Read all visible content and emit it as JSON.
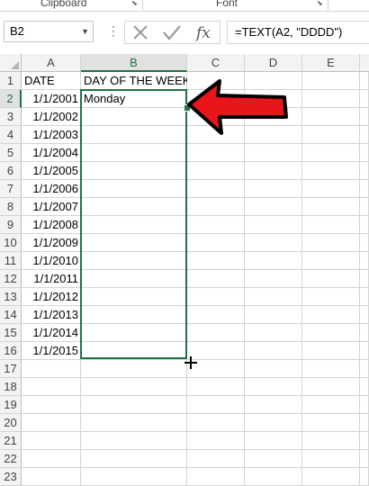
{
  "ribbon": {
    "groups": [
      {
        "label": "Clipboard"
      },
      {
        "label": "Font"
      }
    ]
  },
  "formula_bar": {
    "name_box": "B2",
    "formula": "=TEXT(A2, \"DDDD\")",
    "icons": [
      "cancel-icon",
      "enter-icon",
      "insert-function-icon"
    ]
  },
  "columns": [
    "A",
    "B",
    "C",
    "D",
    "E"
  ],
  "selected_column": "B",
  "selected_row": "2",
  "rows": [
    {
      "num": "1",
      "a": "DATE",
      "b": "DAY OF THE WEEK"
    },
    {
      "num": "2",
      "a": "1/1/2001",
      "b": "Monday"
    },
    {
      "num": "3",
      "a": "1/1/2002",
      "b": ""
    },
    {
      "num": "4",
      "a": "1/1/2003",
      "b": ""
    },
    {
      "num": "5",
      "a": "1/1/2004",
      "b": ""
    },
    {
      "num": "6",
      "a": "1/1/2005",
      "b": ""
    },
    {
      "num": "7",
      "a": "1/1/2006",
      "b": ""
    },
    {
      "num": "8",
      "a": "1/1/2007",
      "b": ""
    },
    {
      "num": "9",
      "a": "1/1/2008",
      "b": ""
    },
    {
      "num": "10",
      "a": "1/1/2009",
      "b": ""
    },
    {
      "num": "11",
      "a": "1/1/2010",
      "b": ""
    },
    {
      "num": "12",
      "a": "1/1/2011",
      "b": ""
    },
    {
      "num": "13",
      "a": "1/1/2012",
      "b": ""
    },
    {
      "num": "14",
      "a": "1/1/2013",
      "b": ""
    },
    {
      "num": "15",
      "a": "1/1/2014",
      "b": ""
    },
    {
      "num": "16",
      "a": "1/1/2015",
      "b": ""
    },
    {
      "num": "17",
      "a": "",
      "b": ""
    },
    {
      "num": "18",
      "a": "",
      "b": ""
    },
    {
      "num": "19",
      "a": "",
      "b": ""
    },
    {
      "num": "20",
      "a": "",
      "b": ""
    },
    {
      "num": "21",
      "a": "",
      "b": ""
    },
    {
      "num": "22",
      "a": "",
      "b": ""
    },
    {
      "num": "23",
      "a": "",
      "b": ""
    }
  ],
  "colors": {
    "selection": "#217346",
    "annotation_arrow": "#e8151b"
  }
}
